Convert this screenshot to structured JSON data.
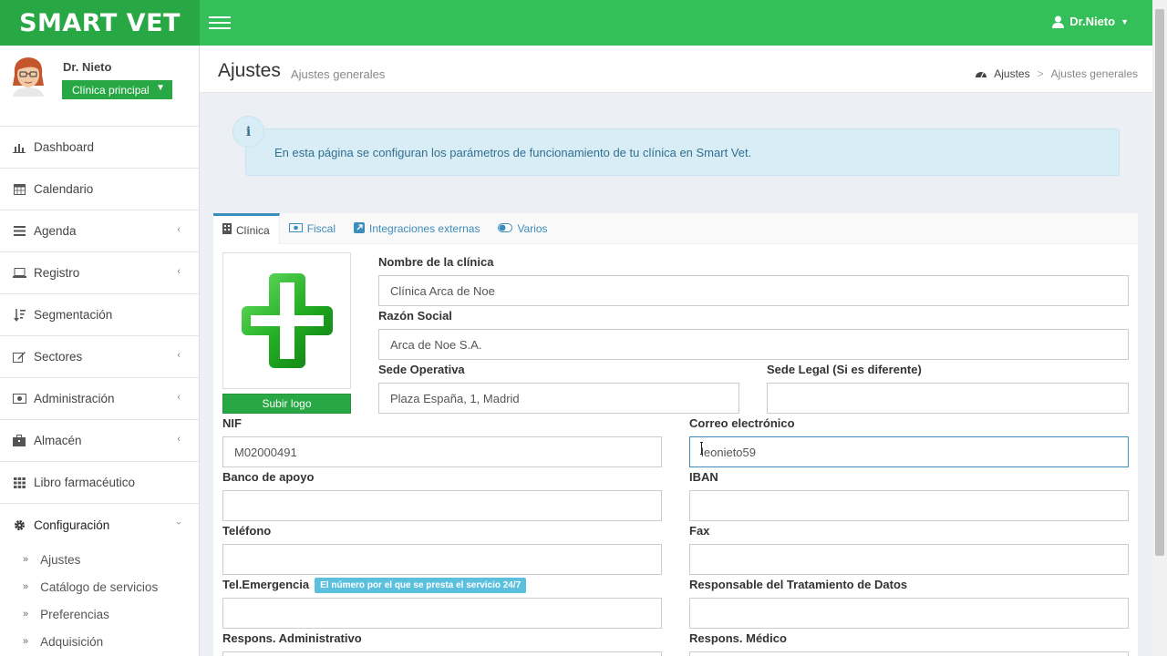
{
  "app": {
    "logo": "SMART VET",
    "user_menu": "Dr.Nieto"
  },
  "sidebar": {
    "user_name": "Dr. Nieto",
    "clinic": "Clínica principal",
    "items": [
      {
        "label": "Dashboard",
        "icon": "bar-chart-icon"
      },
      {
        "label": "Calendario",
        "icon": "calendar-icon"
      },
      {
        "label": "Agenda",
        "icon": "list-icon"
      },
      {
        "label": "Registro",
        "icon": "laptop-icon"
      },
      {
        "label": "Segmentación",
        "icon": "sort-icon"
      },
      {
        "label": "Sectores",
        "icon": "edit-icon"
      },
      {
        "label": "Administración",
        "icon": "money-icon"
      },
      {
        "label": "Almacén",
        "icon": "briefcase-icon"
      },
      {
        "label": "Libro farmacéutico",
        "icon": "grid-icon"
      },
      {
        "label": "Configuración",
        "icon": "gear-icon"
      }
    ],
    "submenu": [
      "Ajustes",
      "Catálogo de servicios",
      "Preferencias",
      "Adquisición"
    ]
  },
  "header": {
    "title": "Ajustes",
    "subtitle": "Ajustes generales",
    "breadcrumb_home": "Ajustes",
    "breadcrumb_current": "Ajustes generales"
  },
  "alert": {
    "text": "En esta página se configuran los parámetros de funcionamiento de tu clínica en Smart Vet."
  },
  "tabs": [
    {
      "label": "Clínica",
      "icon": "building-icon"
    },
    {
      "label": "Fiscal",
      "icon": "money-icon"
    },
    {
      "label": "Integraciones externas",
      "icon": "external-link-icon"
    },
    {
      "label": "Varios",
      "icon": "toggle-icon"
    }
  ],
  "form": {
    "upload_logo": "Subir logo",
    "nombre_label": "Nombre de la clínica",
    "nombre_value": "Clínica Arca de Noe",
    "razon_label": "Razón Social",
    "razon_value": "Arca de Noe S.A.",
    "sede_op_label": "Sede Operativa",
    "sede_op_value": "Plaza España, 1, Madrid",
    "sede_legal_label": "Sede Legal (Si es diferente)",
    "sede_legal_value": "",
    "nif_label": "NIF",
    "nif_value": "M02000491",
    "correo_label": "Correo electrónico",
    "correo_value": "leonieto59",
    "banco_label": "Banco de apoyo",
    "banco_value": "",
    "iban_label": "IBAN",
    "iban_value": "",
    "telefono_label": "Teléfono",
    "telefono_value": "",
    "fax_label": "Fax",
    "fax_value": "",
    "tel_emergencia_label": "Tel.Emergencia",
    "tel_emergencia_badge": "El número por el que se presta el servicio 24/7",
    "tel_emergencia_value": "",
    "responsable_label": "Responsable del Tratamiento de Datos",
    "responsable_value": "",
    "resp_admin_label": "Respons. Administrativo",
    "resp_medico_label": "Respons. Médico"
  },
  "colors": {
    "brand_green": "#28a745",
    "topbar_green": "#34bf5a",
    "info_bg": "#d9edf7",
    "link_blue": "#3c8dbc"
  }
}
